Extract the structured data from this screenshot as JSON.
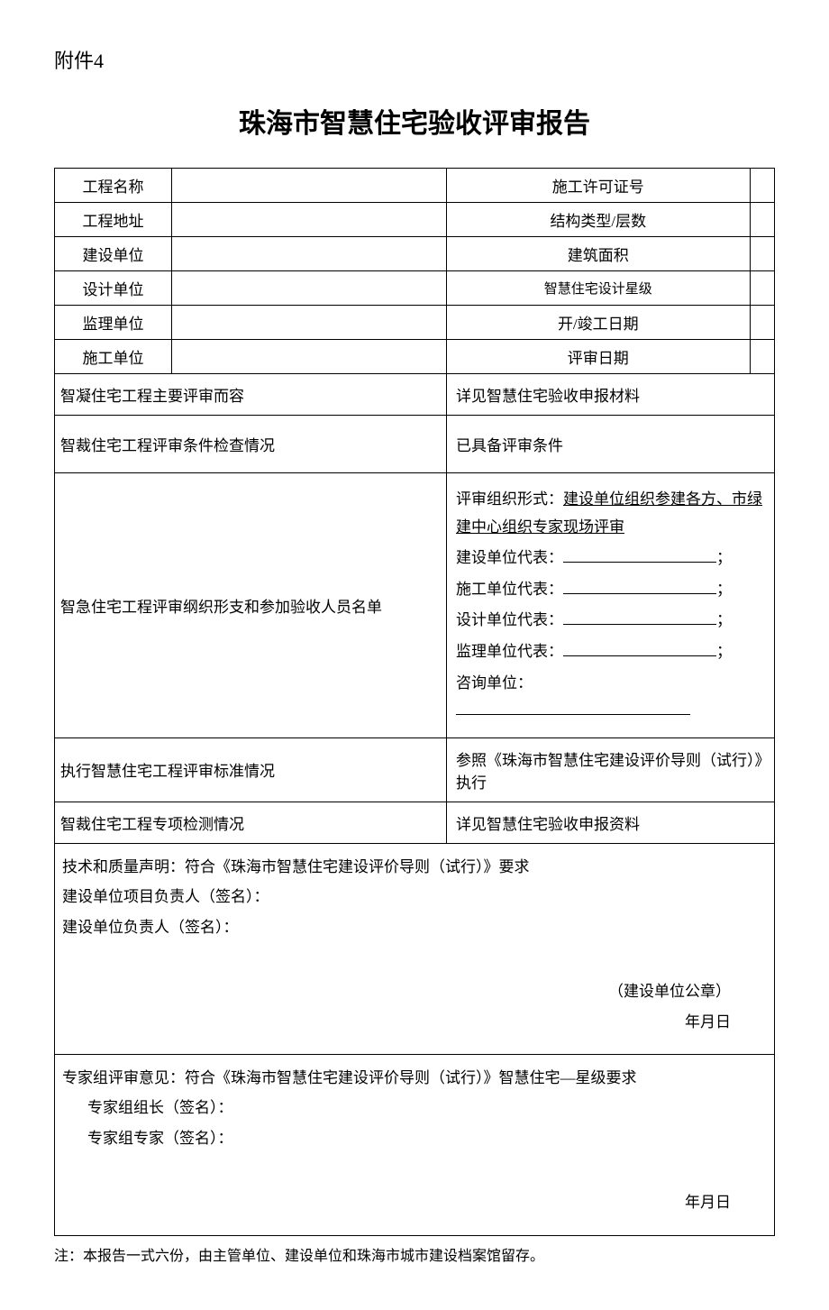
{
  "attachment": "附件4",
  "title": "珠海市智慧住宅验收评审报告",
  "header_rows": [
    {
      "l1": "工程名称",
      "v1": "",
      "l2": "施工许可证号",
      "v2": "",
      "small": false
    },
    {
      "l1": "工程地址",
      "v1": "",
      "l2": "结构类型/层数",
      "v2": "",
      "small": false
    },
    {
      "l1": "建设单位",
      "v1": "",
      "l2": "建筑面积",
      "v2": "",
      "small": false
    },
    {
      "l1": "设计单位",
      "v1": "",
      "l2": "智慧住宅设计星级",
      "v2": "",
      "small": true
    },
    {
      "l1": "监理单位",
      "v1": "",
      "l2": "开/竣工日期",
      "v2": "",
      "small": false
    },
    {
      "l1": "施工单位",
      "v1": "",
      "l2": "评审日期",
      "v2": "",
      "small": false
    }
  ],
  "sections": {
    "review_content": {
      "label": "智凝住宅工程主要评审而容",
      "value": "详见智慧住宅验收申报材料"
    },
    "condition_check": {
      "label": "智裁住宅工程评审条件检查情况",
      "value": "已具备评审条件"
    },
    "organization": {
      "label": "智急住宅工程评审纲织形支和参加验收人员名单",
      "org_form_label": "评审组织形式：",
      "org_form_value": "建设单位组织参建各方、市绿建中心组织专家现场评审",
      "reps": [
        "建设单位代表：",
        "施工单位代表：",
        "设计单位代表：",
        "监理单位代表："
      ],
      "consult": "咨询单位："
    },
    "standard": {
      "label": "执行智慧住宅工程评审标准情况",
      "value": "参照《珠海市智慧住宅建设评价导则（试行）》执行"
    },
    "inspection": {
      "label": "智裁住宅工程专项检测情况",
      "value": "详见智慧住宅验收申报资料"
    }
  },
  "declaration": {
    "l1": "技术和质量声明：符合《珠海市智慧住宅建设评价导则（试行）》要求",
    "l2": "建设单位项目负责人（签名）：",
    "l3": "建设单位负责人（签名）：",
    "seal": "（建设单位公章）",
    "date": "年月日"
  },
  "expert": {
    "l1": "专家组评审意见：符合《珠海市智慧住宅建设评价导则（试行）》智慧住宅—星级要求",
    "l2": "专家组组长（签名）：",
    "l3": "专家组专家（签名）：",
    "date": "年月日"
  },
  "footnote": "注：本报告一式六份，由主管单位、建设单位和珠海市城市建设档案馆留存。"
}
